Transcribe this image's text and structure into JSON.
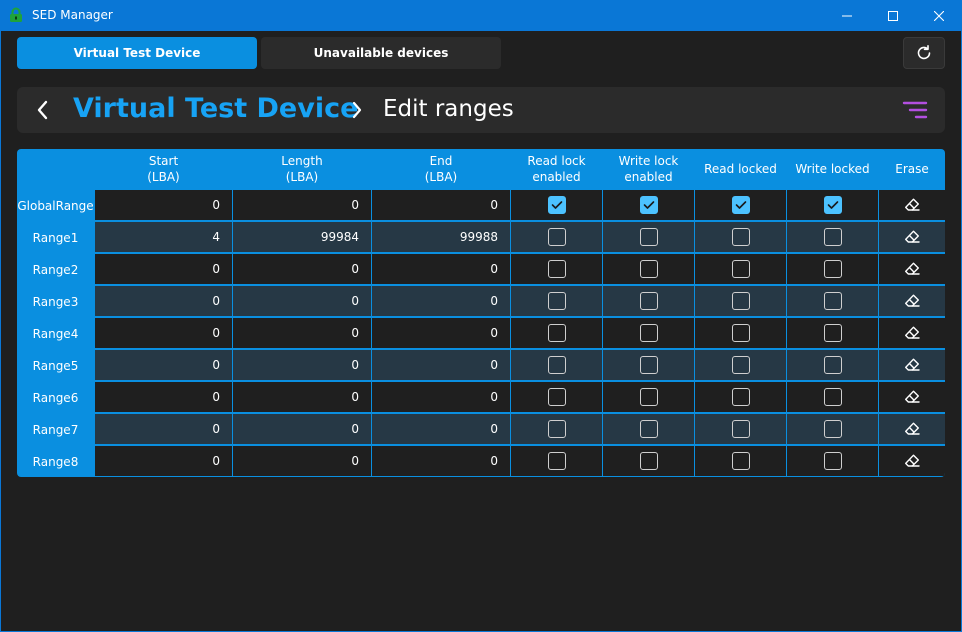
{
  "window": {
    "title": "SED Manager",
    "accent": "#0a77d6"
  },
  "tabs": [
    {
      "label": "Virtual Test Device",
      "active": true
    },
    {
      "label": "Unavailable devices",
      "active": false
    }
  ],
  "icons": {
    "app": "lock-icon",
    "minimize": "minimize-icon",
    "maximize": "maximize-icon",
    "close": "close-icon",
    "refresh": "refresh-icon",
    "back": "chevron-left-icon",
    "separator": "chevron-right-icon",
    "menu": "menu-icon",
    "erase": "eraser-icon"
  },
  "breadcrumb": {
    "device": "Virtual Test Device",
    "page": "Edit ranges"
  },
  "table": {
    "columns": [
      "",
      "Start\n(LBA)",
      "Length\n(LBA)",
      "End\n(LBA)",
      "Read lock\nenabled",
      "Write lock\nenabled",
      "Read locked",
      "Write locked",
      "Erase"
    ],
    "rows": [
      {
        "name": "GlobalRange",
        "start": "0",
        "length": "0",
        "end": "0",
        "read_lock_enabled": true,
        "write_lock_enabled": true,
        "read_locked": true,
        "write_locked": true
      },
      {
        "name": "Range1",
        "start": "4",
        "length": "99984",
        "end": "99988",
        "read_lock_enabled": false,
        "write_lock_enabled": false,
        "read_locked": false,
        "write_locked": false
      },
      {
        "name": "Range2",
        "start": "0",
        "length": "0",
        "end": "0",
        "read_lock_enabled": false,
        "write_lock_enabled": false,
        "read_locked": false,
        "write_locked": false
      },
      {
        "name": "Range3",
        "start": "0",
        "length": "0",
        "end": "0",
        "read_lock_enabled": false,
        "write_lock_enabled": false,
        "read_locked": false,
        "write_locked": false
      },
      {
        "name": "Range4",
        "start": "0",
        "length": "0",
        "end": "0",
        "read_lock_enabled": false,
        "write_lock_enabled": false,
        "read_locked": false,
        "write_locked": false
      },
      {
        "name": "Range5",
        "start": "0",
        "length": "0",
        "end": "0",
        "read_lock_enabled": false,
        "write_lock_enabled": false,
        "read_locked": false,
        "write_locked": false
      },
      {
        "name": "Range6",
        "start": "0",
        "length": "0",
        "end": "0",
        "read_lock_enabled": false,
        "write_lock_enabled": false,
        "read_locked": false,
        "write_locked": false
      },
      {
        "name": "Range7",
        "start": "0",
        "length": "0",
        "end": "0",
        "read_lock_enabled": false,
        "write_lock_enabled": false,
        "read_locked": false,
        "write_locked": false
      },
      {
        "name": "Range8",
        "start": "0",
        "length": "0",
        "end": "0",
        "read_lock_enabled": false,
        "write_lock_enabled": false,
        "read_locked": false,
        "write_locked": false
      }
    ]
  },
  "colors": {
    "accent": "#0a8fe0",
    "breadcrumb_device": "#17a3f5",
    "menu_icon": "#b34fe0",
    "checkbox_checked": "#4cc2ff",
    "row_dark": "#1f1f1f",
    "row_light": "#263845"
  }
}
